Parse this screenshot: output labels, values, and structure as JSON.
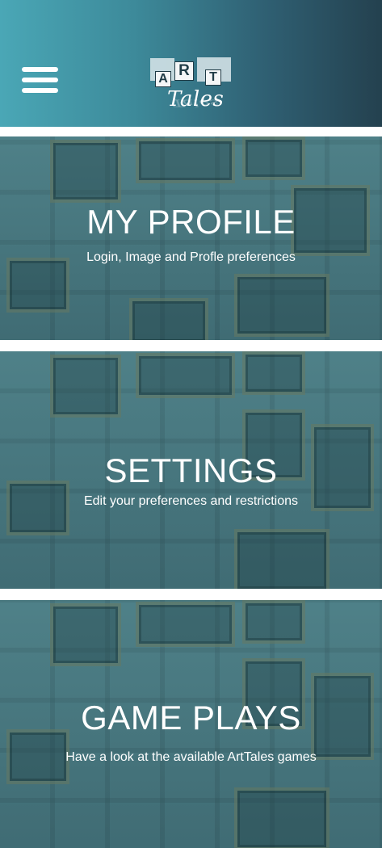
{
  "header": {
    "menu_icon": "hamburger-menu-icon",
    "logo": {
      "letters": [
        "A",
        "R",
        "T"
      ],
      "word": "Tales",
      "colors": {
        "tile_text": "#1f3b46",
        "tile_bg": "#f4f6f7"
      }
    },
    "gradient": [
      "#4aa7b6",
      "#24414f"
    ]
  },
  "cards": [
    {
      "title": "MY PROFILE",
      "subtitle": "Login, Image and Profle preferences"
    },
    {
      "title": "SETTINGS",
      "subtitle": "Edit your preferences and restrictions"
    },
    {
      "title": "GAME PLAYS",
      "subtitle": "Have a look at the available ArtTales games"
    }
  ]
}
